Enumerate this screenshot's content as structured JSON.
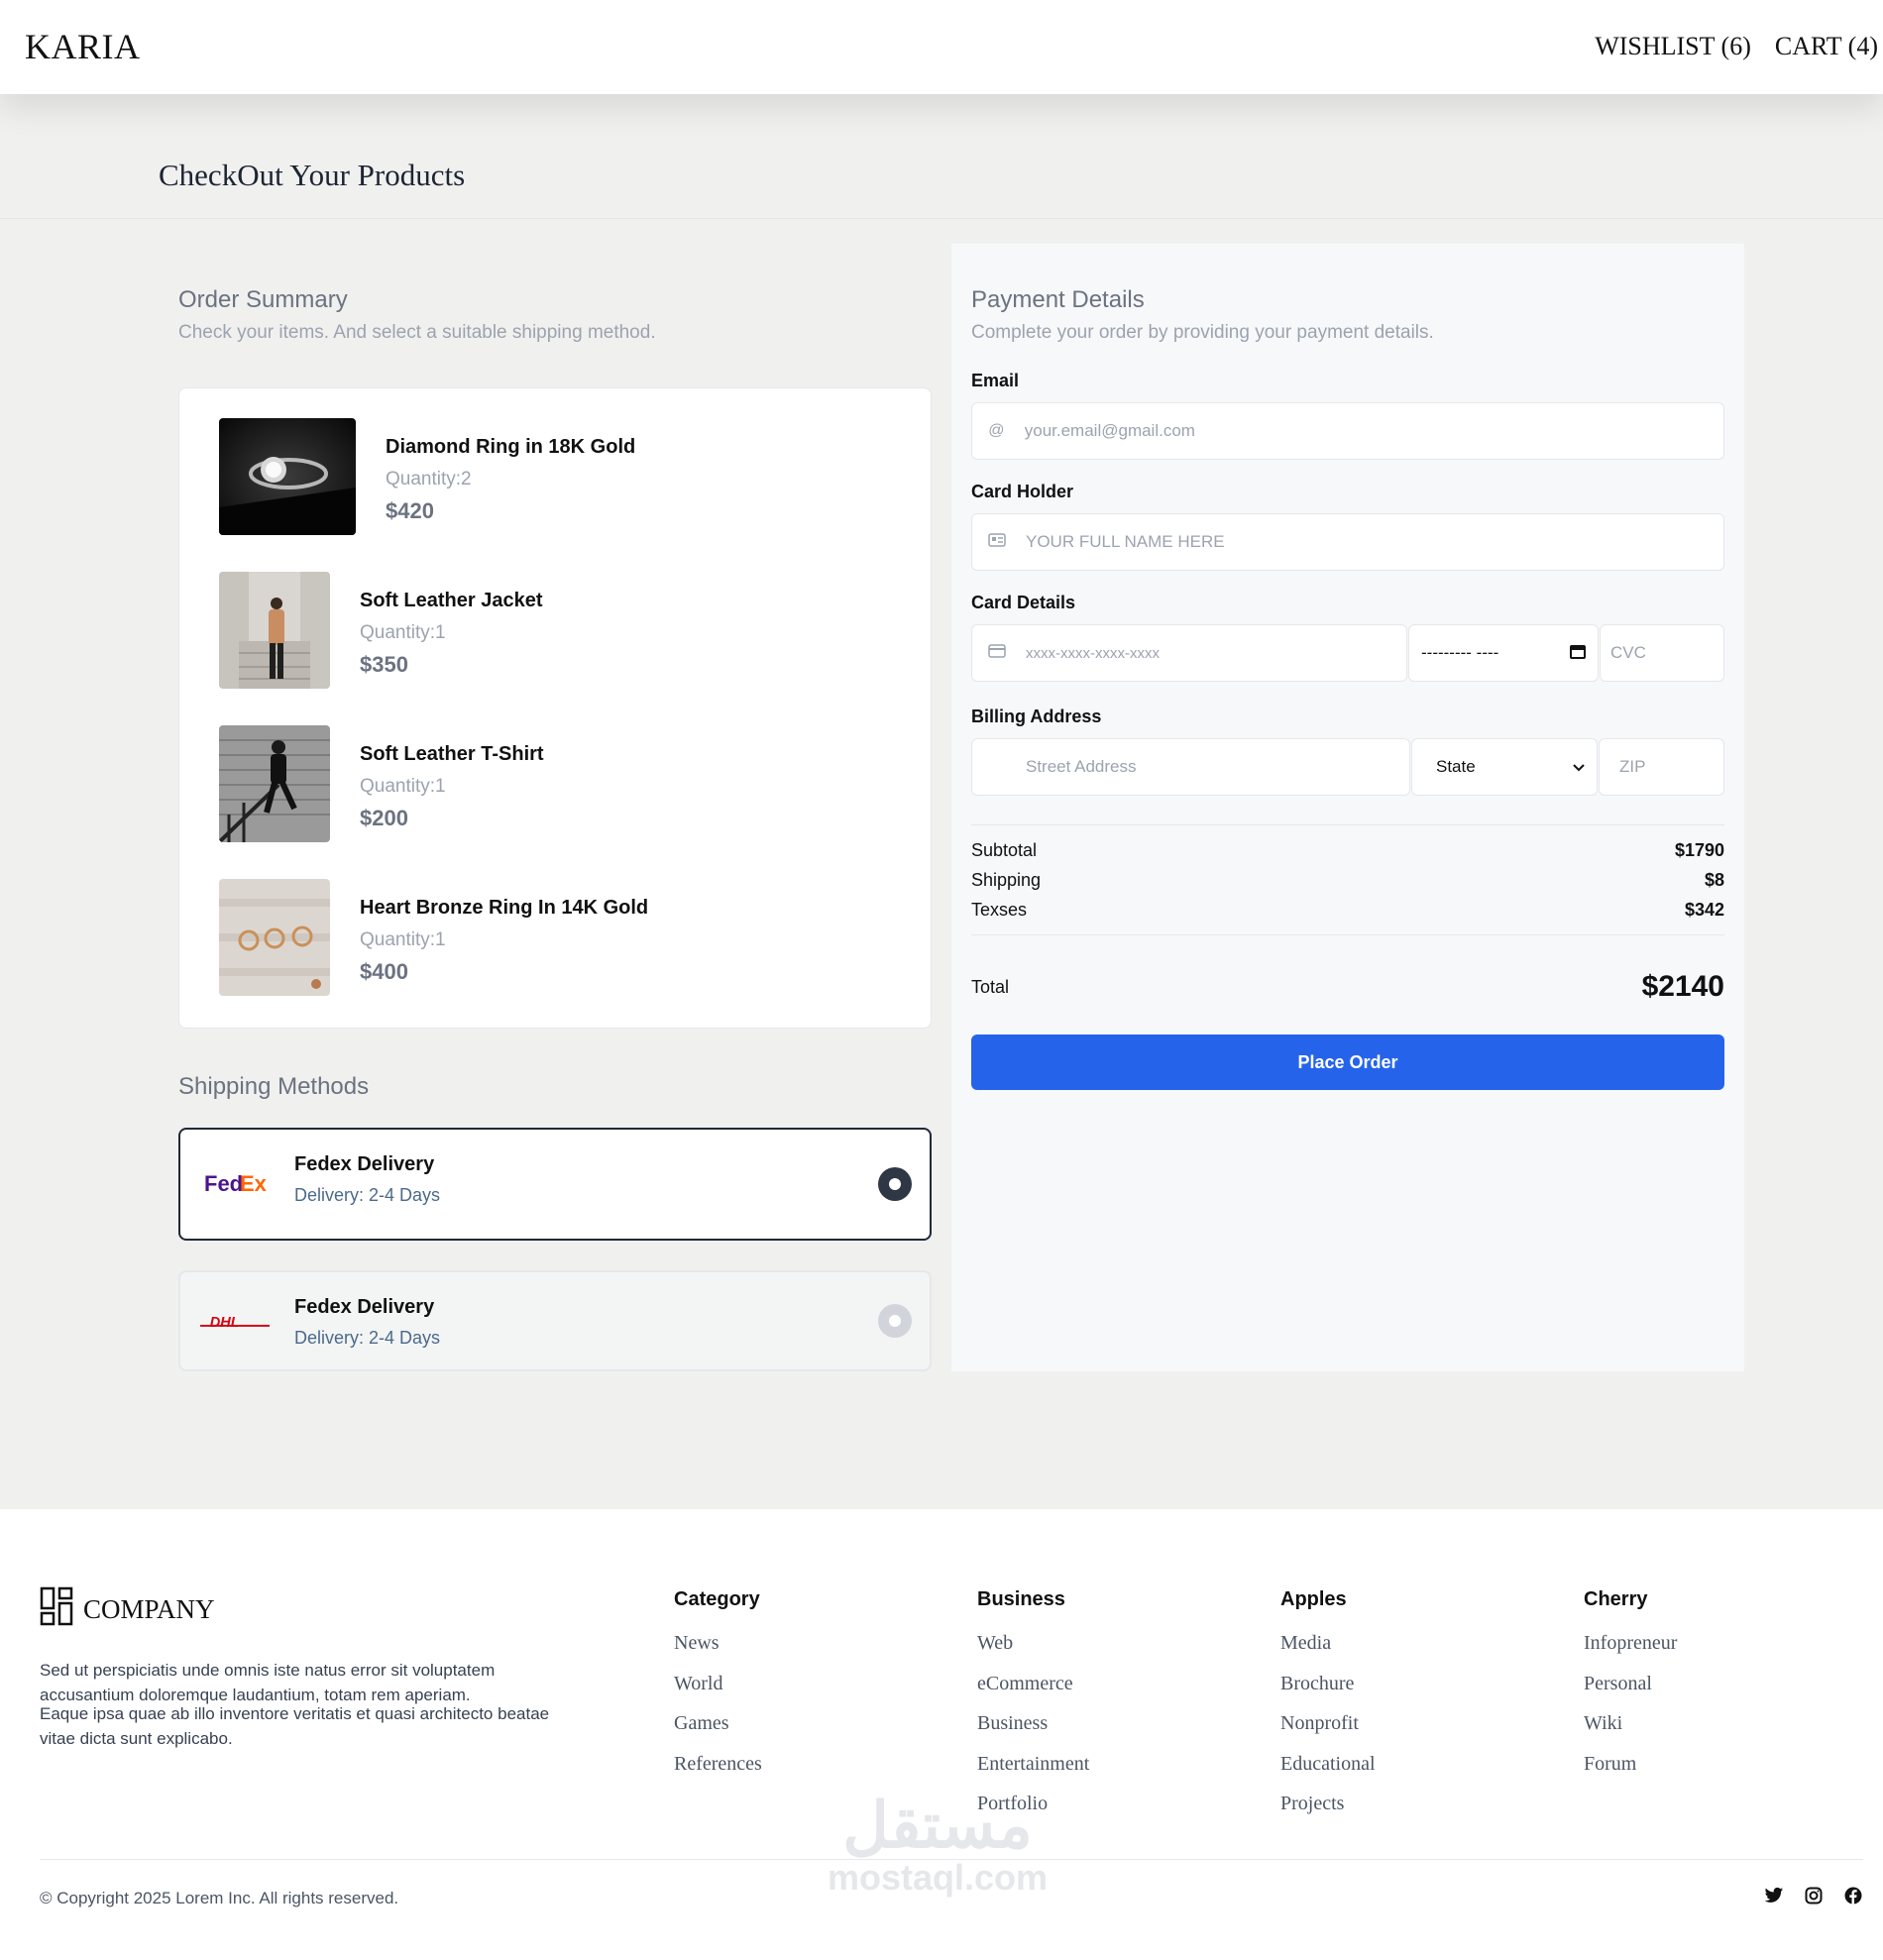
{
  "header": {
    "logo": "KARIA",
    "wishlist": "WISHLIST (6)",
    "cart": "CART (4)"
  },
  "page_title": "CheckOut Your Products",
  "order_summary": {
    "title": "Order Summary",
    "subtitle": "Check your items. And select a suitable shipping method.",
    "items": [
      {
        "name": "Diamond Ring in 18K Gold",
        "quantity": "Quantity:2",
        "price": "$420"
      },
      {
        "name": "Soft Leather Jacket",
        "quantity": "Quantity:1",
        "price": "$350"
      },
      {
        "name": "Soft Leather T-Shirt",
        "quantity": "Quantity:1",
        "price": "$200"
      },
      {
        "name": "Heart Bronze Ring In 14K Gold",
        "quantity": "Quantity:1",
        "price": "$400"
      }
    ]
  },
  "shipping": {
    "title": "Shipping Methods",
    "methods": [
      {
        "logo_text": "FedEx",
        "name": "Fedex Delivery",
        "time": "Delivery: 2-4 Days",
        "selected": true
      },
      {
        "logo_text": "DHL",
        "name": "Fedex Delivery",
        "time": "Delivery: 2-4 Days",
        "selected": false
      }
    ]
  },
  "payment": {
    "title": "Payment Details",
    "subtitle": "Complete your order by providing your payment details.",
    "email_label": "Email",
    "email_placeholder": "your.email@gmail.com",
    "holder_label": "Card Holder",
    "holder_placeholder": "YOUR FULL NAME HERE",
    "card_label": "Card Details",
    "card_placeholder": "xxxx-xxxx-xxxx-xxxx",
    "expiry_placeholder": "--------- ----",
    "cvc_placeholder": "CVC",
    "billing_label": "Billing Address",
    "street_placeholder": "Street Address",
    "state_value": "State",
    "zip_placeholder": "ZIP",
    "subtotal_label": "Subtotal",
    "subtotal_value": "$1790",
    "shipping_label": "Shipping",
    "shipping_value": "$8",
    "taxes_label": "Texses",
    "taxes_value": "$342",
    "total_label": "Total",
    "total_value": "$2140",
    "place_order": "Place Order"
  },
  "footer": {
    "company": "COMPANY",
    "desc1": "Sed ut perspiciatis unde omnis iste natus error sit voluptatem accusantium doloremque laudantium, totam rem aperiam.",
    "desc2": "Eaque ipsa quae ab illo inventore veritatis et quasi architecto beatae vitae dicta sunt explicabo.",
    "columns": [
      {
        "title": "Category",
        "links": [
          "News",
          "World",
          "Games",
          "References"
        ]
      },
      {
        "title": "Business",
        "links": [
          "Web",
          "eCommerce",
          "Business",
          "Entertainment",
          "Portfolio"
        ]
      },
      {
        "title": "Apples",
        "links": [
          "Media",
          "Brochure",
          "Nonprofit",
          "Educational",
          "Projects"
        ]
      },
      {
        "title": "Cherry",
        "links": [
          "Infopreneur",
          "Personal",
          "Wiki",
          "Forum"
        ]
      }
    ],
    "copyright": "© Copyright 2025 Lorem Inc. All rights reserved.",
    "socials": [
      "twitter-icon",
      "instagram-icon",
      "facebook-icon"
    ],
    "watermark_ar": "مستقل",
    "watermark_lat": "mostaql.com"
  },
  "colors": {
    "accent": "#2563eb",
    "page_bg": "#f0f0ef",
    "payment_bg": "#f7f8fa"
  }
}
